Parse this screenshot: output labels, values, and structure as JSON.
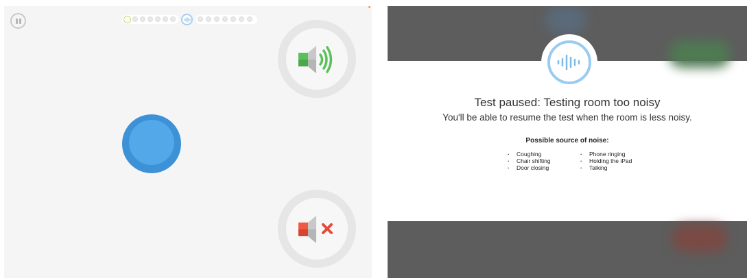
{
  "icons": {
    "pause": "pause-icon",
    "audio_wave": "audio-wave-icon",
    "speaker_loud": "speaker-sound-on-icon",
    "speaker_mute": "speaker-muted-icon"
  },
  "colors": {
    "accent_blue": "#52a8e8",
    "sound_on_green": "#5cc05a",
    "mute_red": "#ef5a45",
    "overlay_gray": "#5d5d5d"
  },
  "progress": {
    "total_dots": 14,
    "current_index": 0
  },
  "dialog": {
    "title": "Test paused: Testing room too noisy",
    "message": "You'll be able to resume the test when the room is less noisy.",
    "sources_heading": "Possible source of noise:",
    "sources_col1": [
      "Coughing",
      "Chair shifting",
      "Door closing"
    ],
    "sources_col2": [
      "Phone ringing",
      "Holding the iPad",
      "Talking"
    ]
  }
}
